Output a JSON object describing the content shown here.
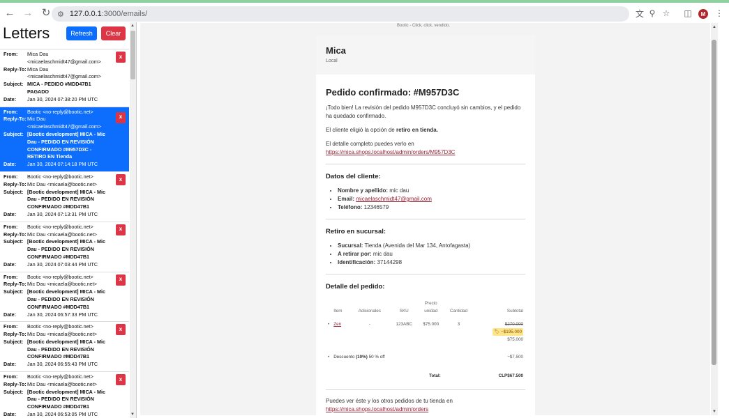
{
  "browser": {
    "url_host": "127.0.0.1",
    "url_path": ":3000/emails/",
    "avatar_letter": "M"
  },
  "sidebar": {
    "title": "Letters",
    "refresh_label": "Refresh",
    "clear_label": "Clear",
    "delete_label": "x",
    "labels": {
      "from": "From:",
      "reply_to": "Reply-To:",
      "subject": "Subject:",
      "date": "Date:"
    },
    "emails": [
      {
        "from": "Mica Dau <micaelaschmidt47@gmail.com>",
        "reply_to": "Mica Dau <micaelaschmidt47@gmail.com>",
        "subject": "MICA - PEDIDO #MDD47B1 PAGADO",
        "date": "Jan 30, 2024 07:38:20 PM UTC",
        "active": false
      },
      {
        "from": "Bootic <no-reply@bootic.net>",
        "reply_to": "Mic Dau <micaelaschmidt47@gmail.com>",
        "subject": "[Bootic development] MICA - Mic Dau - PEDIDO EN REVISIÓN CONFIRMADO #M957D3C - RETIRO EN Tienda",
        "date": "Jan 30, 2024 07:14:18 PM UTC",
        "active": true
      },
      {
        "from": "Bootic <no-reply@bootic.net>",
        "reply_to": "Mic Dau <micaela@bootic.net>",
        "subject": "[Bootic development] MICA - Mic Dau - PEDIDO EN REVISIÓN CONFIRMADO #MDD47B1",
        "date": "Jan 30, 2024 07:13:31 PM UTC",
        "active": false
      },
      {
        "from": "Bootic <no-reply@bootic.net>",
        "reply_to": "Mic Dau <micaela@bootic.net>",
        "subject": "[Bootic development] MICA - Mic Dau - PEDIDO EN REVISIÓN CONFIRMADO #MDD47B1",
        "date": "Jan 30, 2024 07:03:44 PM UTC",
        "active": false
      },
      {
        "from": "Bootic <no-reply@bootic.net>",
        "reply_to": "Mic Dau <micaela@bootic.net>",
        "subject": "[Bootic development] MICA - Mic Dau - PEDIDO EN REVISIÓN CONFIRMADO #MDD47B1",
        "date": "Jan 30, 2024 06:57:33 PM UTC",
        "active": false
      },
      {
        "from": "Bootic <no-reply@bootic.net>",
        "reply_to": "Mic Dau <micaela@bootic.net>",
        "subject": "[Bootic development] MICA - Mic Dau - PEDIDO EN REVISIÓN CONFIRMADO #MDD47B1",
        "date": "Jan 30, 2024 06:55:43 PM UTC",
        "active": false
      },
      {
        "from": "Bootic <no-reply@bootic.net>",
        "reply_to": "Mic Dau <micaela@bootic.net>",
        "subject": "[Bootic development] MICA - Mic Dau - PEDIDO EN REVISIÓN CONFIRMADO #MDD47B1",
        "date": "Jan 30, 2024 06:53:05 PM UTC",
        "active": false
      }
    ]
  },
  "email": {
    "banner_alt": "Bootic - Click, click, vendido.",
    "store_name": "Mica",
    "store_sub": "Local",
    "heading": "Pedido confirmado: #M957D3C",
    "intro": "¡Todo bien! La revisión del pedido M957D3C concluyó sin cambios, y el pedido ha quedado confirmado.",
    "pickup_prefix": "El cliente eligió la opción de ",
    "pickup_strong": "retiro en tienda.",
    "detail_text": "El detalle completo puedes verlo en",
    "detail_link": "https://mica.shops.localhost/admin/orders/M957D3C",
    "client_title": "Datos del cliente:",
    "client": [
      {
        "label": "Nombre y apellido:",
        "value": " mic dau"
      },
      {
        "label": "Email:",
        "value": "micaelaschmidt47@gmail.com"
      },
      {
        "label": "Teléfono:",
        "value": " 12346579"
      }
    ],
    "pickup_title": "Retiro en sucursal:",
    "pickup": [
      {
        "label": "Sucursal:",
        "value": " Tienda (Avenida del Mar 134, Antofagasta)"
      },
      {
        "label": "A retirar por:",
        "value": " mic dau"
      },
      {
        "label": "Identificación:",
        "value": " 37144298"
      }
    ],
    "order_title": "Detalle del pedido:",
    "table_headers": {
      "item": "Item",
      "adicionales": "Adicionales",
      "sku": "SKU",
      "precio": "Precio unidad",
      "cantidad": "Cantidad",
      "subtotal": "Subtotal"
    },
    "line": {
      "item": "Zen",
      "adicionales": "-",
      "sku": "123ABC",
      "precio": "$75.000",
      "cantidad": "3",
      "subtotal_old": "$270.000",
      "discount": "−$195.000",
      "subtotal": "$75.000"
    },
    "discount_row": {
      "label": "Descuento",
      "strong": "(10%)",
      "suffix": " 50 % off",
      "value": "−$7.500"
    },
    "total_label": "Total:",
    "total_value": "CLP$67.500",
    "footer_text": "Puedes ver éste y los otros pedidos de tu tienda en",
    "footer_link": "https://mica.shops.localhost/admin/orders"
  }
}
